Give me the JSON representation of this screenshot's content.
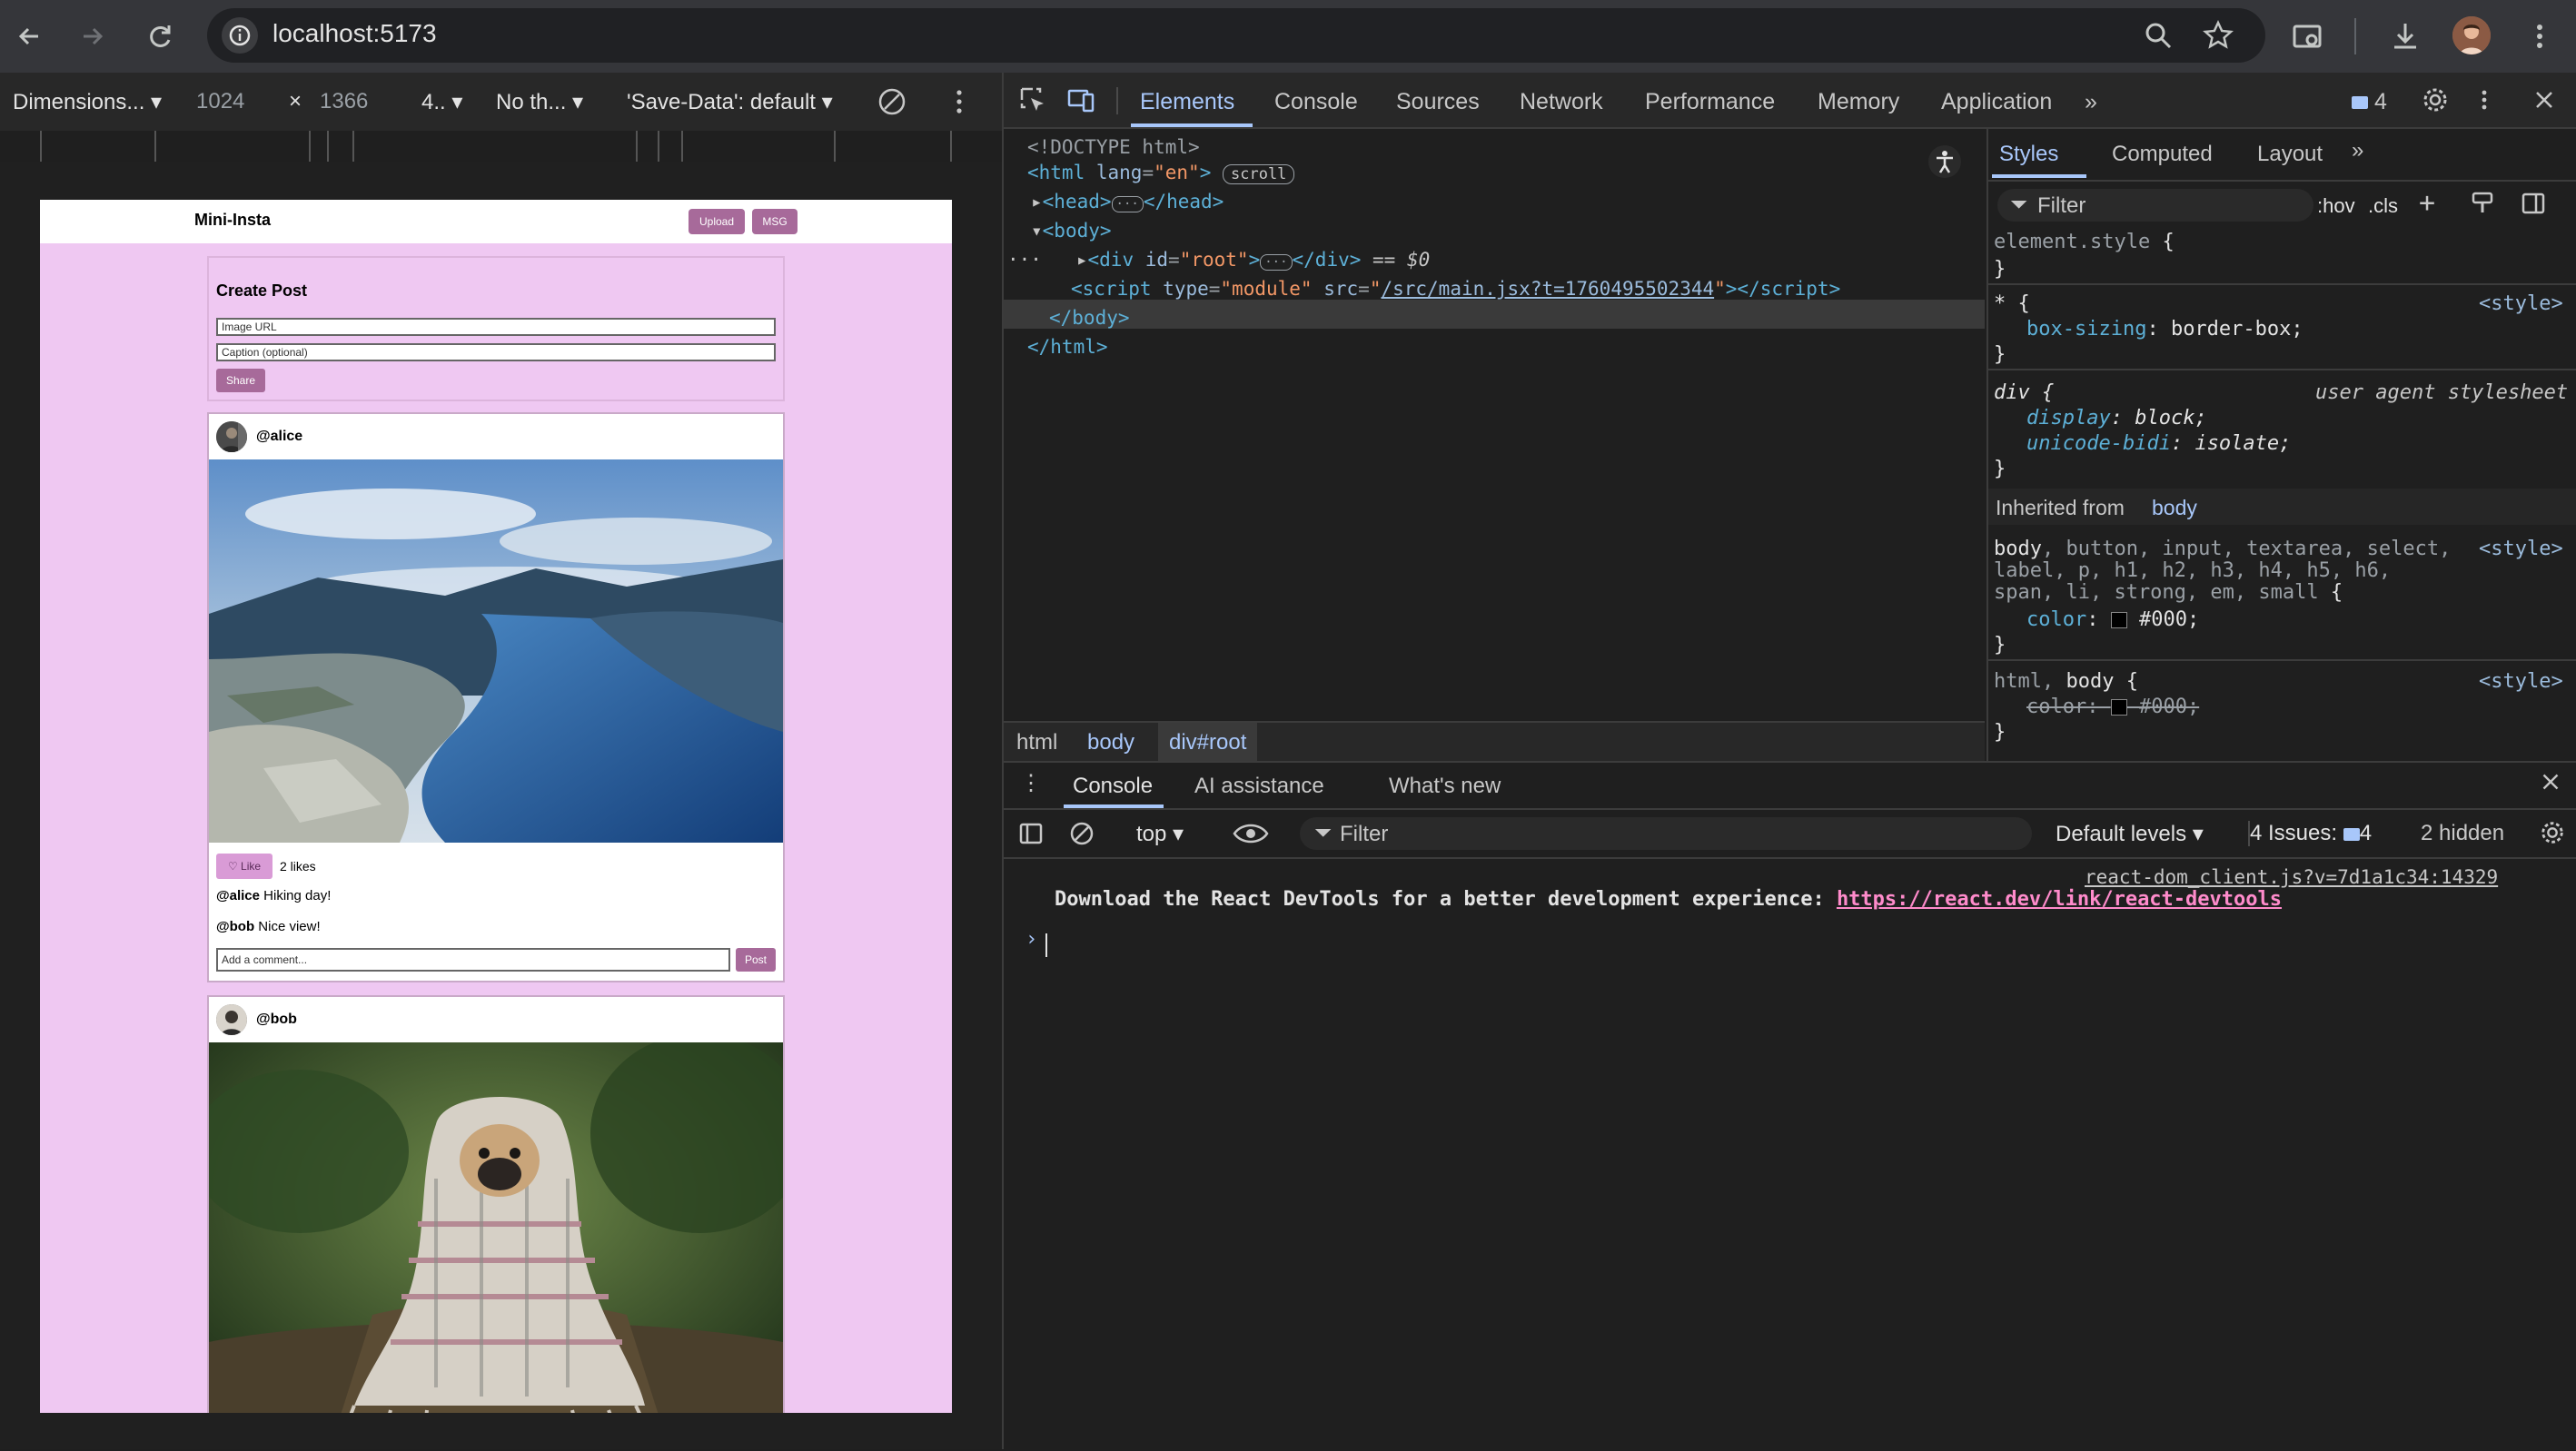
{
  "browser": {
    "url": "localhost:5173"
  },
  "device_toolbar": {
    "dimensions": "Dimensions...",
    "width": "1024",
    "times": "×",
    "height": "1366",
    "zoom": "4..",
    "throttle": "No th...",
    "save_data": "'Save-Data': default"
  },
  "app": {
    "logo": "Mini-Insta",
    "upload_btn": "Upload",
    "msg_btn": "MSG",
    "create_title": "Create Post",
    "image_url_placeholder": "Image URL",
    "caption_placeholder": "Caption (optional)",
    "share_btn": "Share",
    "posts": [
      {
        "user": "@alice",
        "like_btn": "Like",
        "likes": "2 likes",
        "caption_user": "@alice",
        "caption": "Hiking day!",
        "comment_user": "@bob",
        "comment": "Nice view!",
        "comment_placeholder": "Add a comment...",
        "post_btn": "Post"
      },
      {
        "user": "@bob"
      }
    ]
  },
  "devtools": {
    "tabs": [
      "Elements",
      "Console",
      "Sources",
      "Network",
      "Performance",
      "Memory",
      "Application"
    ],
    "issues_count": "4",
    "dom": {
      "doctype": "<!DOCTYPE html>",
      "scroll_badge": "scroll",
      "root_marker": "== $0",
      "script_src": "/src/main.jsx?t=1760495502344"
    },
    "breadcrumbs": [
      "html",
      "body",
      "div#root"
    ],
    "styles_tabs": [
      "Styles",
      "Computed",
      "Layout"
    ],
    "styles_filter": "Filter",
    "hov": ":hov",
    "cls": ".cls",
    "inherited_label": "Inherited from",
    "inherited_from": "body",
    "ua_label": "user agent stylesheet",
    "style_label": "<style>",
    "drawer_tabs": [
      "Console",
      "AI assistance",
      "What's new"
    ],
    "context": "top",
    "console_filter": "Filter",
    "levels": "Default levels",
    "issues_label": "4 Issues:",
    "issues_badge": "4",
    "hidden": "2 hidden",
    "console_source": "react-dom_client.js?v=7d1a1c34:14329",
    "console_message": "Download the React DevTools for a better development experience: ",
    "console_link": "https://react.dev/link/react-devtools"
  }
}
